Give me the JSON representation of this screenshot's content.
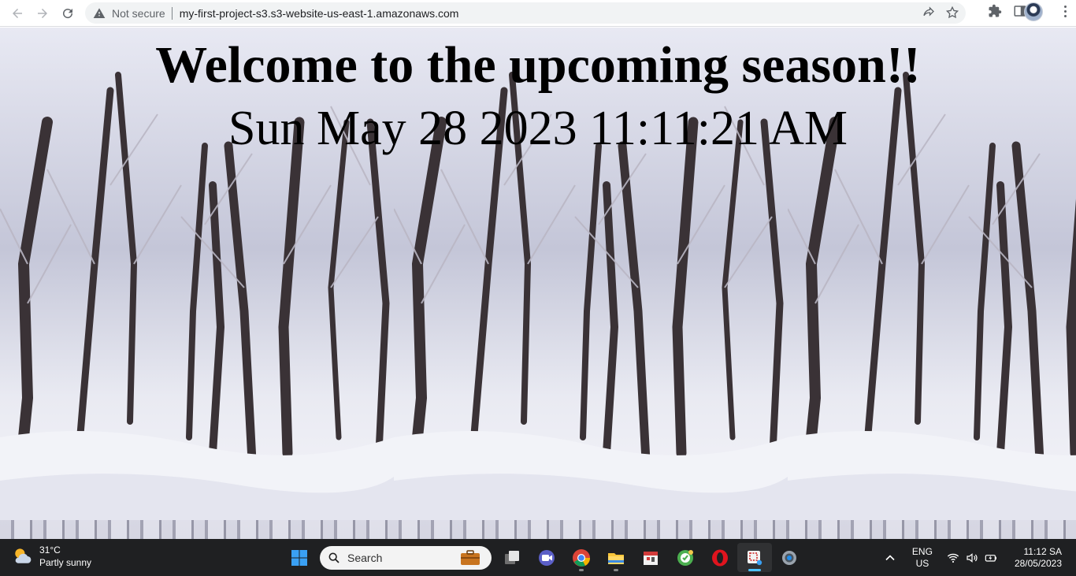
{
  "browser": {
    "security_label": "Not secure",
    "url": "my-first-project-s3.s3-website-us-east-1.amazonaws.com"
  },
  "page": {
    "headline": "Welcome to the upcoming season!!",
    "datetime": "Sun May 28 2023 11:11:21 AM"
  },
  "taskbar": {
    "weather": {
      "temp": "31°C",
      "condition": "Partly sunny"
    },
    "search_label": "Search",
    "pinned": [
      {
        "name": "task-view-icon"
      },
      {
        "name": "meet-icon"
      },
      {
        "name": "chrome-icon"
      },
      {
        "name": "file-explorer-icon"
      },
      {
        "name": "calendar-app-icon"
      },
      {
        "name": "green-app-icon"
      },
      {
        "name": "opera-icon"
      },
      {
        "name": "snipping-tool-icon"
      },
      {
        "name": "settings-icon"
      }
    ],
    "language": {
      "line1": "ENG",
      "line2": "US"
    },
    "clock": {
      "time": "11:12 SA",
      "date": "28/05/2023"
    }
  },
  "colors": {
    "taskbar_bg": "#1f2022",
    "omnibox_bg": "#f1f3f4",
    "active_accent": "#4cc2ff"
  }
}
